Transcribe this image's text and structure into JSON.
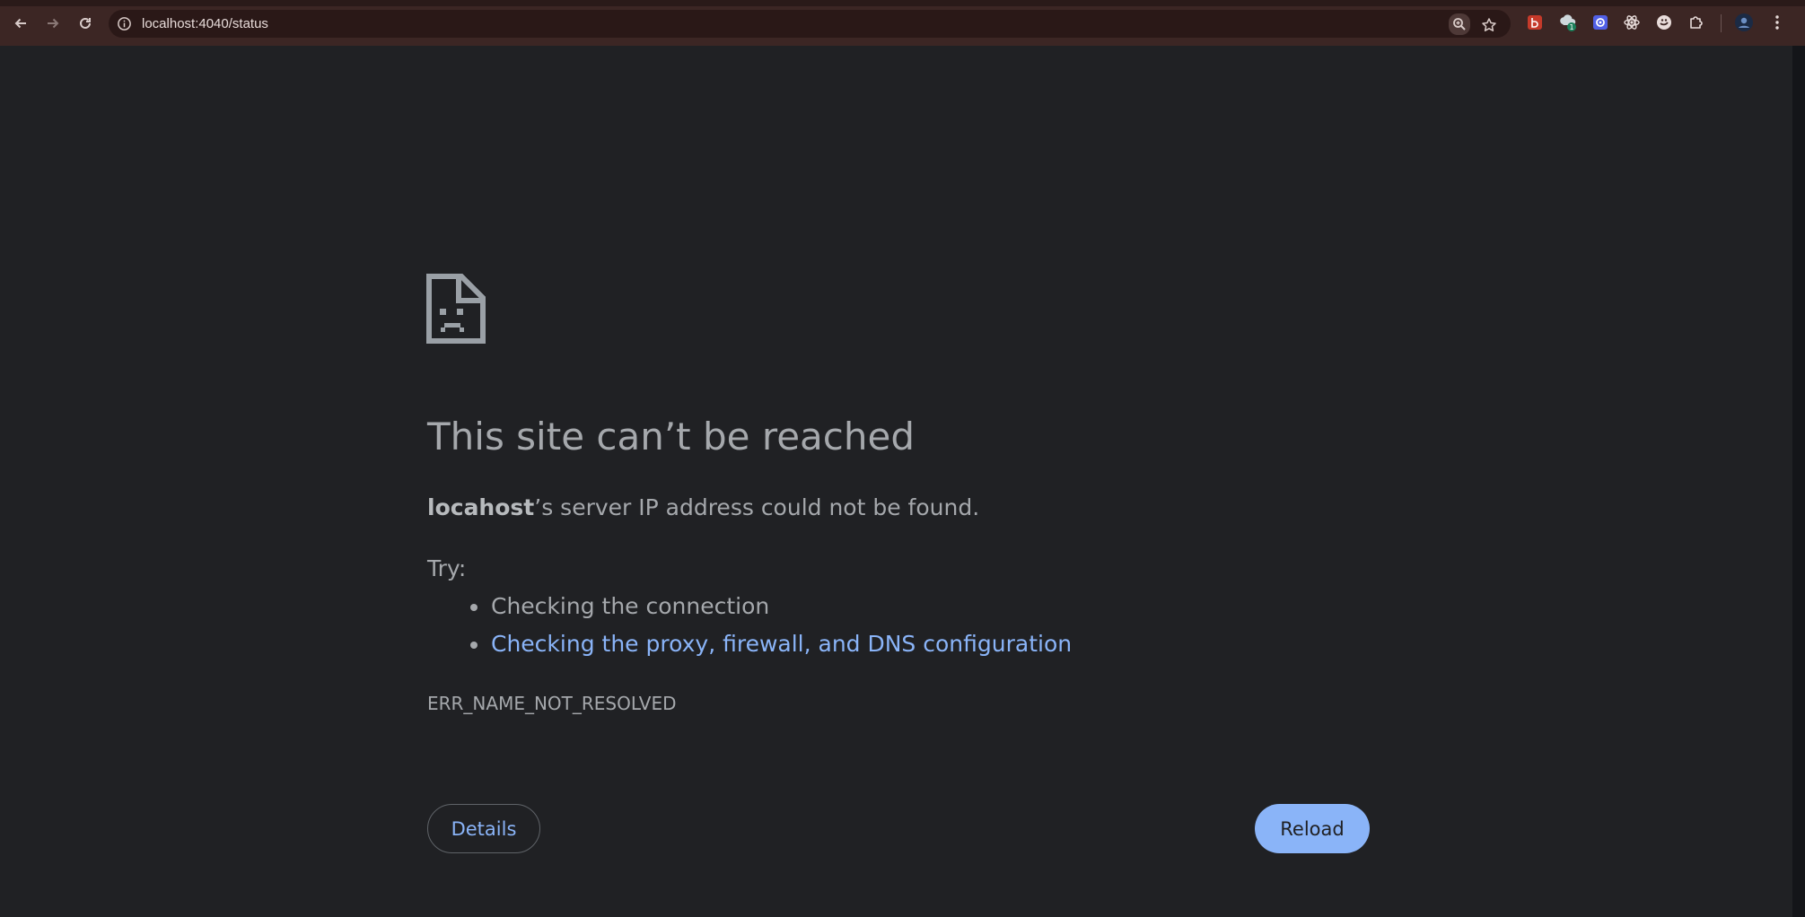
{
  "browser": {
    "url": "localhost:4040/status",
    "icons": {
      "back": "arrow-left-icon",
      "forward": "arrow-right-icon",
      "reload": "reload-icon",
      "site_info": "info-icon",
      "zoom": "zoom-icon",
      "bookmark": "star-icon",
      "extensions": "puzzle-icon",
      "menu": "more-vertical-icon"
    },
    "extension_badge": "1",
    "colors": {
      "frame": "#3c2624",
      "omnibox": "#2a1817"
    }
  },
  "error_page": {
    "title": "This site can’t be reached",
    "host": "locahost",
    "summary_rest": "’s server IP address could not be found.",
    "try_label": "Try:",
    "suggestions": [
      "Checking the connection",
      "Checking the proxy, firewall, and DNS configuration"
    ],
    "error_code": "ERR_NAME_NOT_RESOLVED",
    "details_label": "Details",
    "reload_label": "Reload",
    "colors": {
      "background": "#202124",
      "text": "#a5a8ac",
      "link": "#8ab4f8",
      "primary_button": "#8ab4f8"
    }
  }
}
